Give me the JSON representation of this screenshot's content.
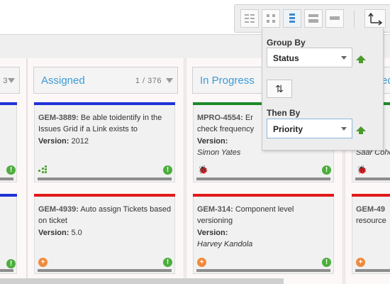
{
  "toolbar": {
    "icons": [
      "grid-view-icon",
      "card-view-icon",
      "lane-view-icon",
      "split-view-icon",
      "row-view-icon",
      "axes-icon"
    ]
  },
  "group_popup": {
    "group_by_label": "Group By",
    "group_by_value": "Status",
    "then_by_label": "Then By",
    "then_by_value": "Priority"
  },
  "columns": [
    {
      "title": "",
      "count": "3"
    },
    {
      "title": "Assigned",
      "count": "1 / 376"
    },
    {
      "title": "In Progress",
      "count": ""
    },
    {
      "title": "ed",
      "count": ""
    }
  ],
  "cards": {
    "assigned_1": {
      "key": "GEM-3889:",
      "title": "Be able toidentify in the Issues Grid if a Link exists to",
      "version_label": "Version:",
      "version": "2012"
    },
    "assigned_2": {
      "key": "GEM-4939:",
      "title": "Auto assign Tickets based on ticket",
      "version_label": "Version:",
      "version": "5.0"
    },
    "progress_1": {
      "key": "MPRO-4554:",
      "title": "Er",
      "title2": "check frequency",
      "version_label": "Version:",
      "resource": "Simon Yates"
    },
    "progress_2": {
      "key": "GEM-314:",
      "title": "Component level versioning",
      "version_label": "Version:",
      "resource": "Harvey Kandola"
    },
    "edge_1": {
      "resource": "Saar Cohe"
    },
    "edge_2": {
      "key": "GEM-49",
      "title": "resource"
    }
  },
  "colors": {
    "blue": "#1f33d6",
    "red": "#e11a1a",
    "green": "#1e8a2a",
    "accent_text": "#3c9ad6"
  }
}
